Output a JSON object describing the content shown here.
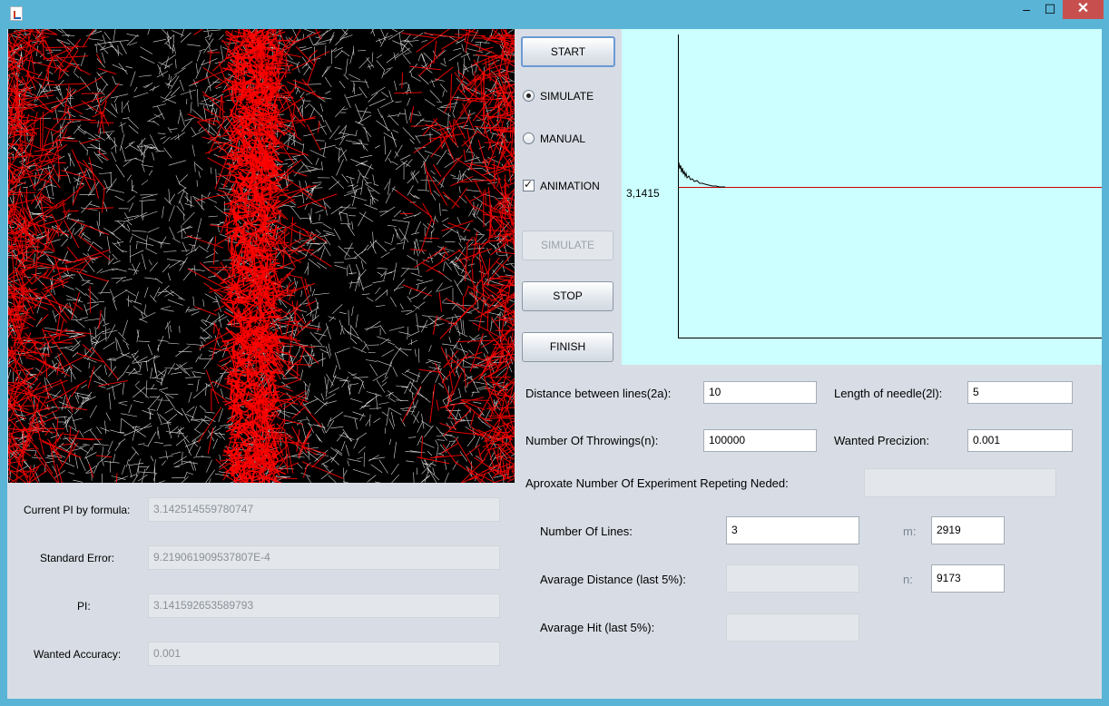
{
  "window": {
    "title": "",
    "controls": {
      "minimize": "–",
      "maximize": "☐",
      "close": "✕"
    }
  },
  "buttons": {
    "start": "START",
    "simulate": "SIMULATE",
    "stop": "STOP",
    "finish": "FINISH"
  },
  "mode": {
    "simulate_label": "SIMULATE",
    "simulate_selected": true,
    "manual_label": "MANUAL",
    "manual_selected": false
  },
  "animation": {
    "label": "ANIMATION",
    "checked": true,
    "check_glyph": "✓"
  },
  "graph": {
    "reference_label": "3,1415",
    "reference_value": 3.1415,
    "line_color": "#cc0000",
    "background": "#ccffff"
  },
  "params": {
    "distance_label": "Distance between lines(2a):",
    "distance_value": "10",
    "needle_label": "Length of needle(2l):",
    "needle_value": "5",
    "throwings_label": "Number Of Throwings(n):",
    "throwings_value": "100000",
    "precision_label": "Wanted Precizion:",
    "precision_value": "0.001",
    "repeat_label": "Aproxate Number Of Experiment Repeting Neded:",
    "repeat_value": ""
  },
  "lines": {
    "count_label": "Number Of Lines:",
    "count_value": "3",
    "m_label": "m:",
    "m_value": "2919",
    "avg_distance_label": "Avarage Distance  (last 5%):",
    "avg_distance_value": "",
    "n_label": "n:",
    "n_value": "9173",
    "avg_hit_label": "Avarage Hit (last 5%):",
    "avg_hit_value": ""
  },
  "results": {
    "current_pi_label": "Current PI by formula:",
    "current_pi_value": "3.142514559780747",
    "std_error_label": "Standard Error:",
    "std_error_value": "9.219061909537807E-4",
    "pi_label": "PI:",
    "pi_value": "3.141592653589793",
    "accuracy_label": "Wanted Accuracy:",
    "accuracy_value": "0.001"
  },
  "colors": {
    "needle": "#ff0000",
    "canvas_background": "#000000",
    "panel": "#d8dde5",
    "titlebar": "#5ab4d6"
  }
}
